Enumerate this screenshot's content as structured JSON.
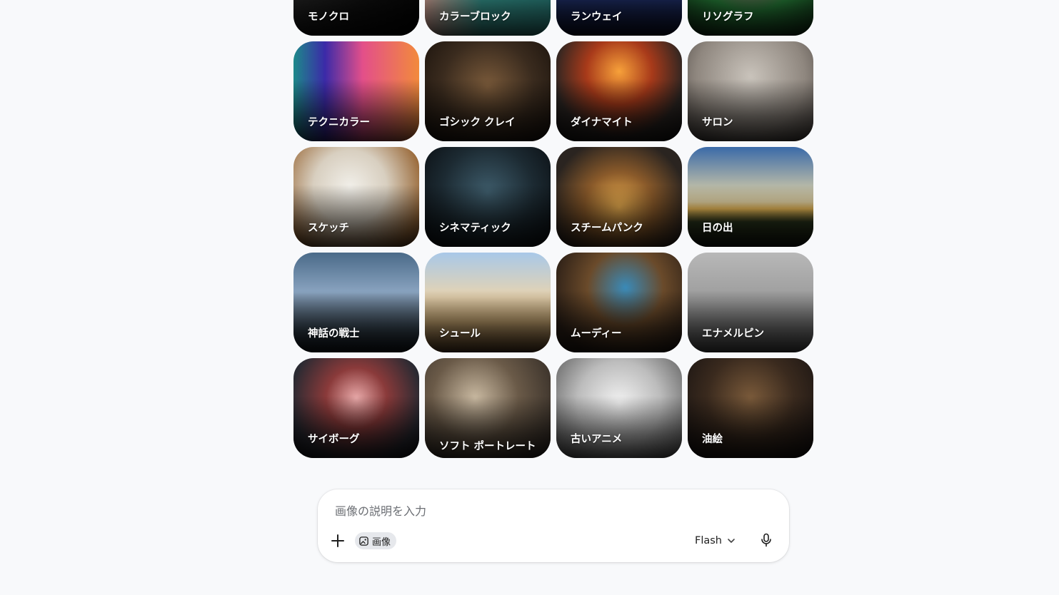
{
  "style_tiles": [
    {
      "label": "モノクロ"
    },
    {
      "label": "カラーブロック"
    },
    {
      "label": "ランウェイ"
    },
    {
      "label": "リソグラフ"
    },
    {
      "label": "テクニカラー"
    },
    {
      "label": "ゴシック クレイ"
    },
    {
      "label": "ダイナマイト"
    },
    {
      "label": "サロン"
    },
    {
      "label": "スケッチ"
    },
    {
      "label": "シネマティック"
    },
    {
      "label": "スチームパンク"
    },
    {
      "label": "日の出"
    },
    {
      "label": "神話の戦士"
    },
    {
      "label": "シュール"
    },
    {
      "label": "ムーディー"
    },
    {
      "label": "エナメルピン"
    },
    {
      "label": "サイボーグ"
    },
    {
      "label": "ソフト ポートレート"
    },
    {
      "label": "古いアニメ"
    },
    {
      "label": "油絵"
    }
  ],
  "composer": {
    "placeholder": "画像の説明を入力",
    "tool_chip_label": "画像",
    "model_label": "Flash"
  },
  "icons": {
    "add": "plus-icon",
    "tool": "image-icon",
    "model_menu": "chevron-down-icon",
    "voice": "mic-icon"
  },
  "colors": {
    "background": "#f8f9fb",
    "composer_bg": "#ffffff",
    "chip_bg": "#e6e8ec"
  }
}
